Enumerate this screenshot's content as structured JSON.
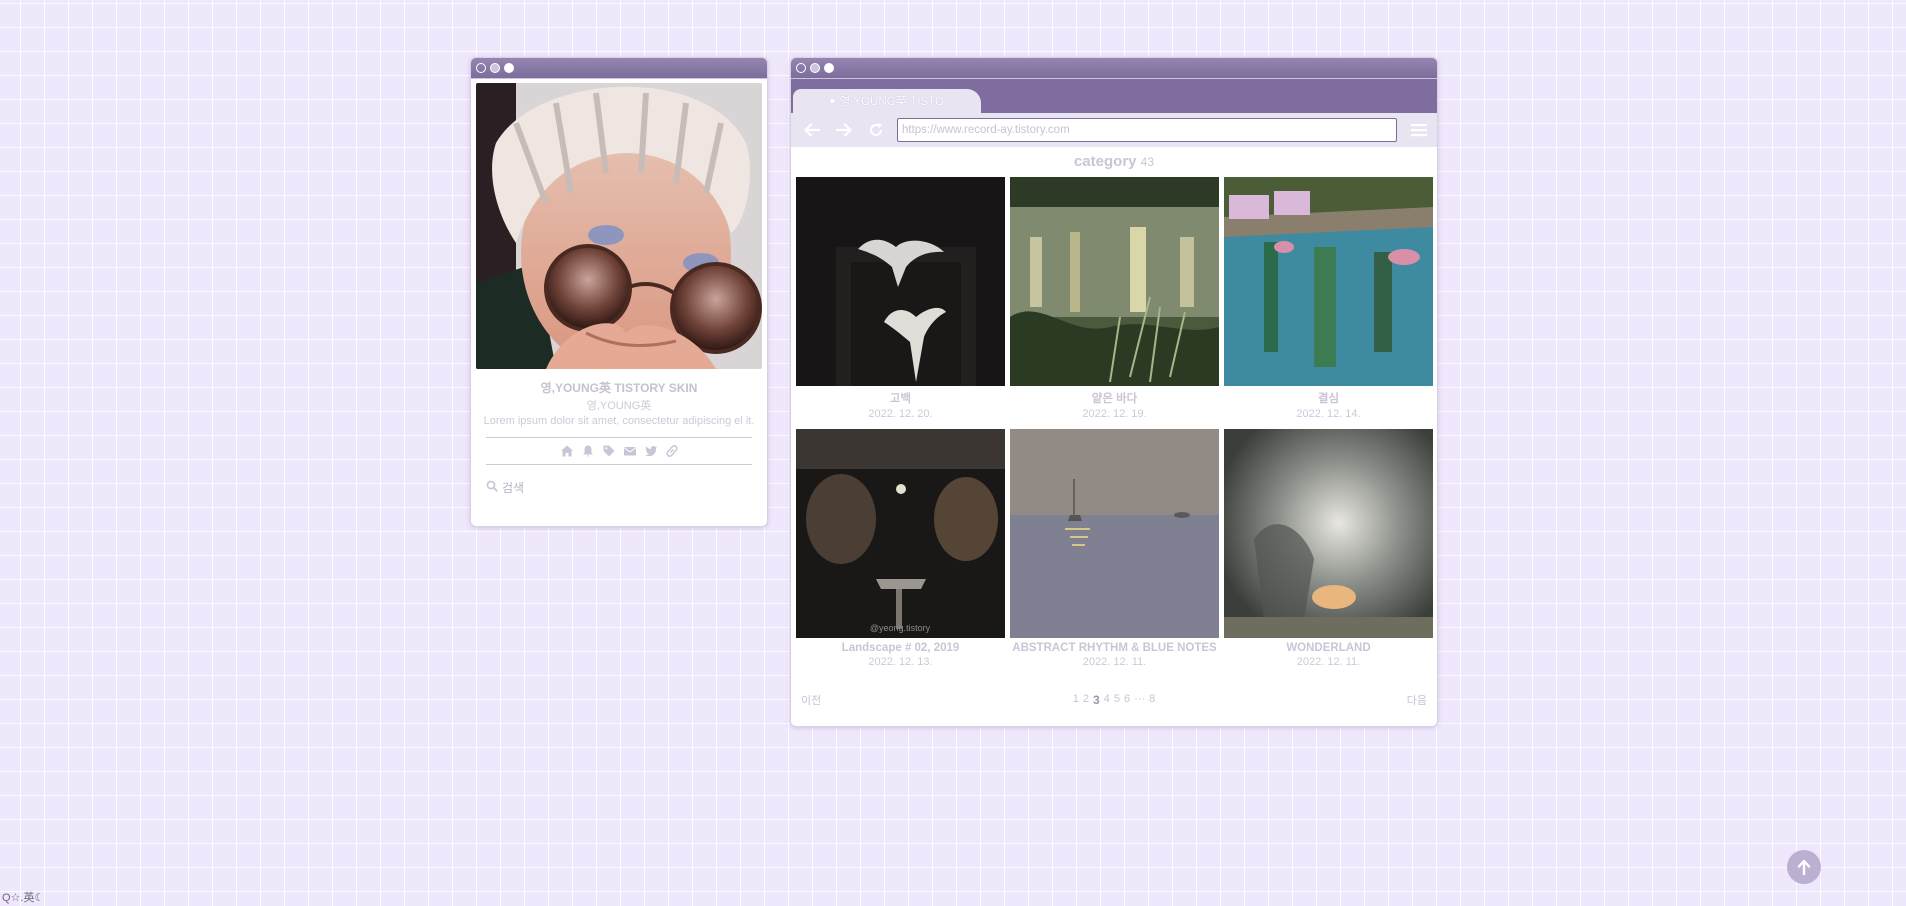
{
  "profile": {
    "blog_title": "영,YOUNG英 TISTORY SKIN",
    "owner": "영,YOUNG英",
    "description": "Lorem ipsum dolor sit amet, consectetur adipiscing el it.",
    "icons": [
      "home-icon",
      "bell-icon",
      "tag-icon",
      "mail-icon",
      "twitter-icon",
      "link-icon"
    ],
    "search_placeholder": "검색"
  },
  "browser": {
    "tab_label": "영,YOUNG英 TISTO",
    "url": "https://www.record-ay.tistory.com",
    "category_label": "category",
    "category_count": "43",
    "posts": [
      {
        "title": "고백",
        "date": "2022. 12. 20."
      },
      {
        "title": "얕은 바다",
        "date": "2022. 12. 19."
      },
      {
        "title": "결심",
        "date": "2022. 12. 14."
      },
      {
        "title": "Landscape # 02, 2019",
        "date": "2022. 12. 13."
      },
      {
        "title": "ABSTRACT RHYTHM & BLUE NOTES",
        "date": "2022. 12. 11."
      },
      {
        "title": "WONDERLAND",
        "date": "2022. 12. 11."
      }
    ],
    "thumb_watermark": "@yeong.tistory",
    "pager": {
      "prev": "이전",
      "next": "다음",
      "pages": [
        "1",
        "2",
        "3",
        "4",
        "5",
        "6",
        "···",
        "8"
      ],
      "current": "3"
    }
  },
  "footer": {
    "corner_text": "Q☆.英☾"
  },
  "colors": {
    "background": "#efe7fb",
    "titlebar": "#7c6d9c",
    "tabstrip": "#7e6d9e",
    "toolbar": "#e9e4f1",
    "muted_text": "#cbc4d6",
    "top_button": "#bcb0d2"
  }
}
